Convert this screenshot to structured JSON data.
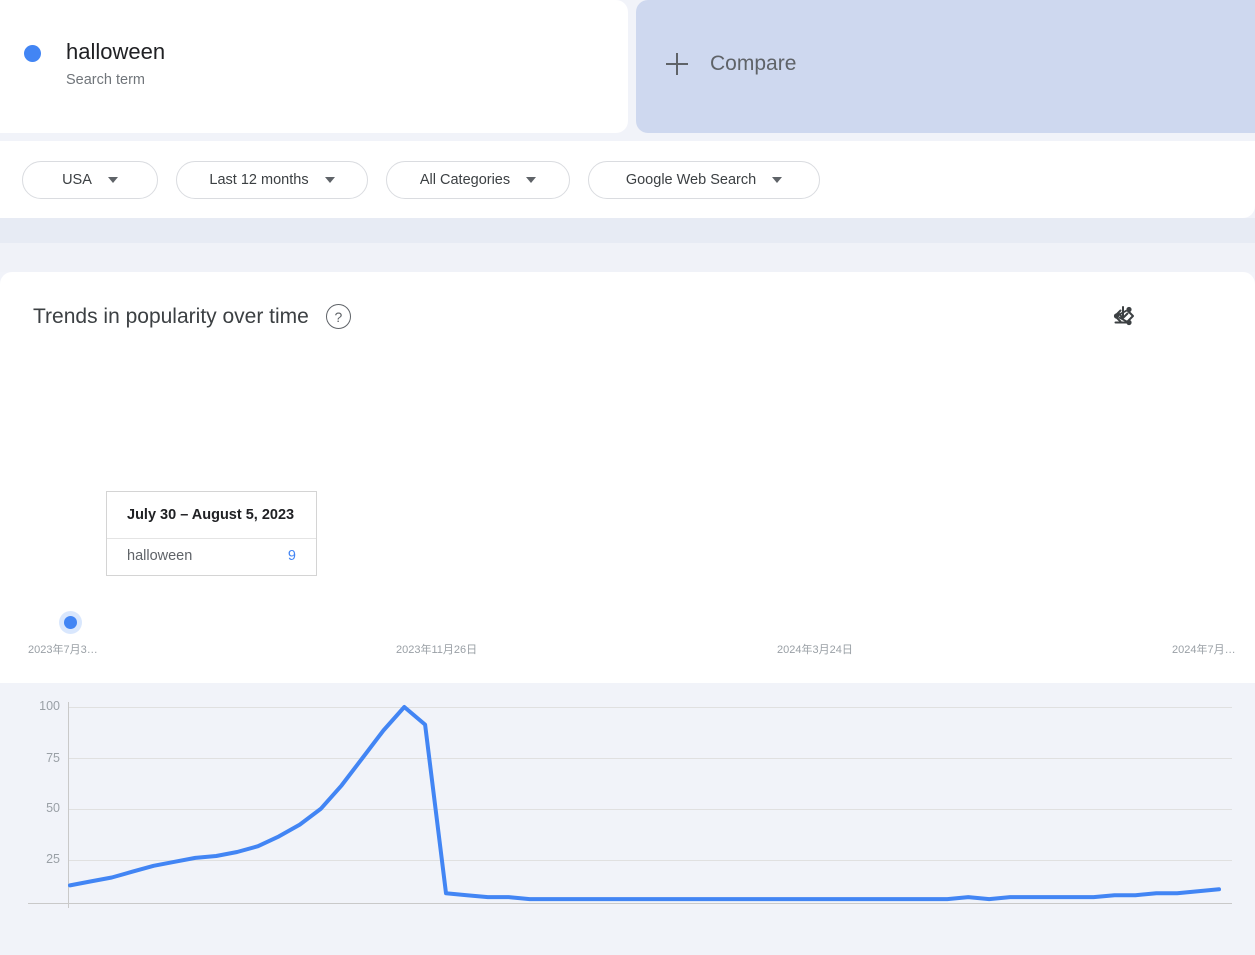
{
  "term": {
    "name": "halloween",
    "subtitle": "Search term",
    "dot_color": "#4285f4"
  },
  "compare": {
    "label": "Compare",
    "icon": "plus-icon",
    "background": "#ced8ef"
  },
  "filters": [
    {
      "label": "USA",
      "icon": "chevron-down-icon"
    },
    {
      "label": "Last 12 months",
      "icon": "chevron-down-icon"
    },
    {
      "label": "All Categories",
      "icon": "chevron-down-icon"
    },
    {
      "label": "Google Web Search",
      "icon": "chevron-down-icon"
    }
  ],
  "chart_header": {
    "title": "Trends in popularity over time",
    "help_icon": "help-circle-icon",
    "help_glyph": "?",
    "actions": [
      {
        "name": "download-icon"
      },
      {
        "name": "embed-code-icon"
      },
      {
        "name": "share-icon"
      }
    ]
  },
  "tooltip": {
    "date_range": "July 30 – August 5, 2023",
    "series_name": "halloween",
    "value": "9",
    "value_color": "#4285f4"
  },
  "chart_data": {
    "type": "line",
    "title": "Trends in popularity over time",
    "xlabel": "",
    "ylabel": "",
    "ylim": [
      0,
      100
    ],
    "yticks": [
      25,
      50,
      75,
      100
    ],
    "grid": true,
    "legend": "none",
    "line_color": "#4285f4",
    "xtick_labels": [
      "2023年7月3…",
      "2023年11月26日",
      "2024年3月24日",
      "2024年7月…"
    ],
    "xtick_positions": [
      70,
      446,
      822,
      1198
    ],
    "highlight_point": {
      "index": 0,
      "label": "July 30 – August 5, 2023",
      "value": 9
    },
    "series": [
      {
        "name": "halloween",
        "values": [
          9,
          11,
          13,
          16,
          19,
          21,
          23,
          24,
          26,
          29,
          34,
          40,
          48,
          60,
          74,
          88,
          100,
          91,
          5,
          4,
          3,
          3,
          2,
          2,
          2,
          2,
          2,
          2,
          2,
          2,
          2,
          2,
          2,
          2,
          2,
          2,
          2,
          2,
          2,
          2,
          2,
          2,
          2,
          3,
          2,
          3,
          3,
          3,
          3,
          3,
          4,
          4,
          5,
          5,
          6,
          7
        ]
      }
    ]
  }
}
